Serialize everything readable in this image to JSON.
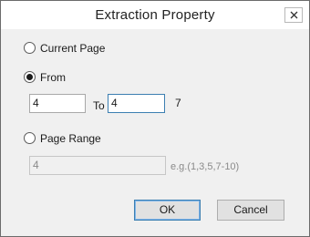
{
  "window": {
    "title": "Extraction  Property"
  },
  "options": {
    "current_page_label": "Current Page",
    "from_label": "From",
    "page_range_label": "Page Range",
    "selected": "from"
  },
  "from_range": {
    "from_value": "4",
    "to_label": "To",
    "to_value": "4",
    "total_pages": "7"
  },
  "page_range": {
    "value": "4",
    "hint": "e.g.(1,3,5,7-10)"
  },
  "buttons": {
    "ok": "OK",
    "cancel": "Cancel"
  },
  "icons": {
    "close": "close-icon"
  }
}
